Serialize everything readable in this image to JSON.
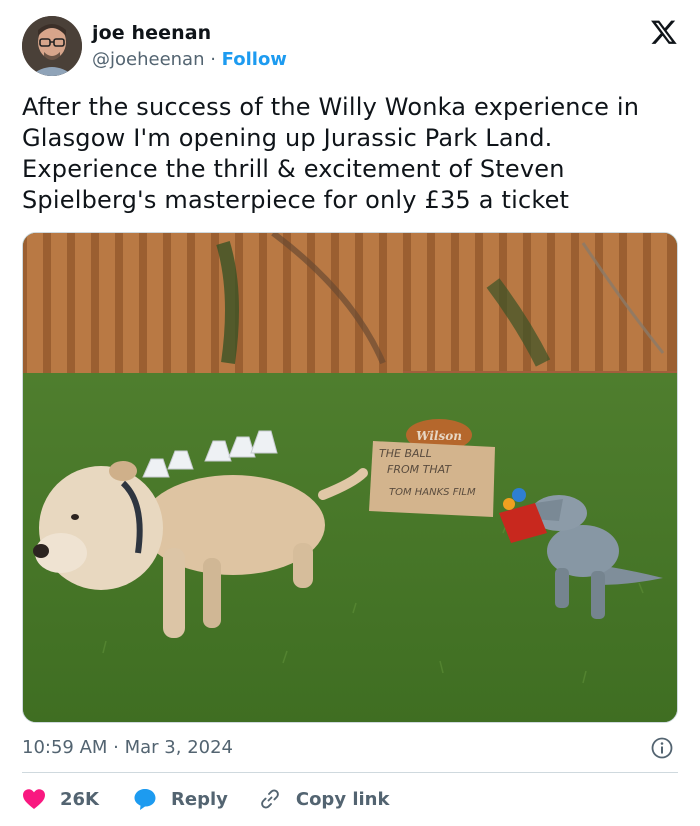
{
  "author": {
    "display_name": "joe heenan",
    "handle": "@joeheenan",
    "separator": " · ",
    "follow_label": "Follow"
  },
  "platform_icon": "x-logo-icon",
  "tweet": {
    "lines": [
      "After the success of the Willy Wonka experience in",
      "Glasgow I'm opening up Jurassic Park Land.",
      "Experience the thrill & excitement of Steven",
      "Spielberg's masterpiece for only £35 a ticket"
    ]
  },
  "media": {
    "ball_label": "Wilson",
    "sign_lines": [
      "THE BALL",
      "FROM THAT",
      "TOM HANKS FILM"
    ]
  },
  "meta": {
    "time": "10:59 AM",
    "separator": " · ",
    "date": "Mar 3, 2024"
  },
  "actions": {
    "like_count": "26K",
    "reply_label": "Reply",
    "copy_link_label": "Copy link"
  },
  "colors": {
    "like": "#f91880",
    "reply": "#1d9bf0",
    "follow": "#1d9bf0",
    "muted": "#536471"
  }
}
